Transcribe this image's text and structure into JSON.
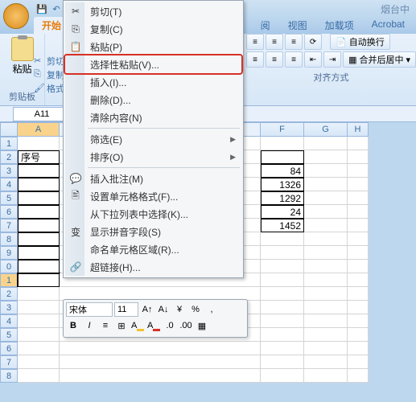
{
  "titlebar": {
    "app_title_partial": "烟台中"
  },
  "tabs": {
    "start": "开始",
    "review_partial": "阅",
    "view": "视图",
    "addins": "加载项",
    "acrobat": "Acrobat"
  },
  "clipboard": {
    "paste": "粘贴",
    "cut": "剪切",
    "copy": "复制",
    "format_painter": "格式刷",
    "group_title": "剪贴板"
  },
  "alignment": {
    "wrap_text": "自动换行",
    "merge_center": "合并后居中",
    "group_title": "对齐方式"
  },
  "namebox": "A11",
  "columns": {
    "A": "A",
    "F": "F",
    "G": "G",
    "H": "H"
  },
  "rowheaders": [
    "1",
    "2",
    "3",
    "4",
    "5",
    "6",
    "7",
    "8",
    "9",
    "0",
    "1",
    "2",
    "3",
    "4",
    "5",
    "6",
    "7",
    "8"
  ],
  "cells": {
    "A2": "序号",
    "F3": "84",
    "F4": "1326",
    "F5": "1292",
    "F6": "24",
    "F7": "1452"
  },
  "context_menu": {
    "cut": "剪切(T)",
    "copy": "复制(C)",
    "paste": "粘贴(P)",
    "paste_special": "选择性粘贴(V)...",
    "insert": "插入(I)...",
    "delete": "删除(D)...",
    "clear": "清除内容(N)",
    "filter": "筛选(E)",
    "sort": "排序(O)",
    "insert_comment": "插入批注(M)",
    "format_cells": "设置单元格格式(F)...",
    "pick_from_list": "从下拉列表中选择(K)...",
    "show_pinyin": "显示拼音字段(S)",
    "name_range": "命名单元格区域(R)...",
    "hyperlink": "超链接(H)..."
  },
  "mini_toolbar": {
    "font": "宋体",
    "size": "11"
  }
}
